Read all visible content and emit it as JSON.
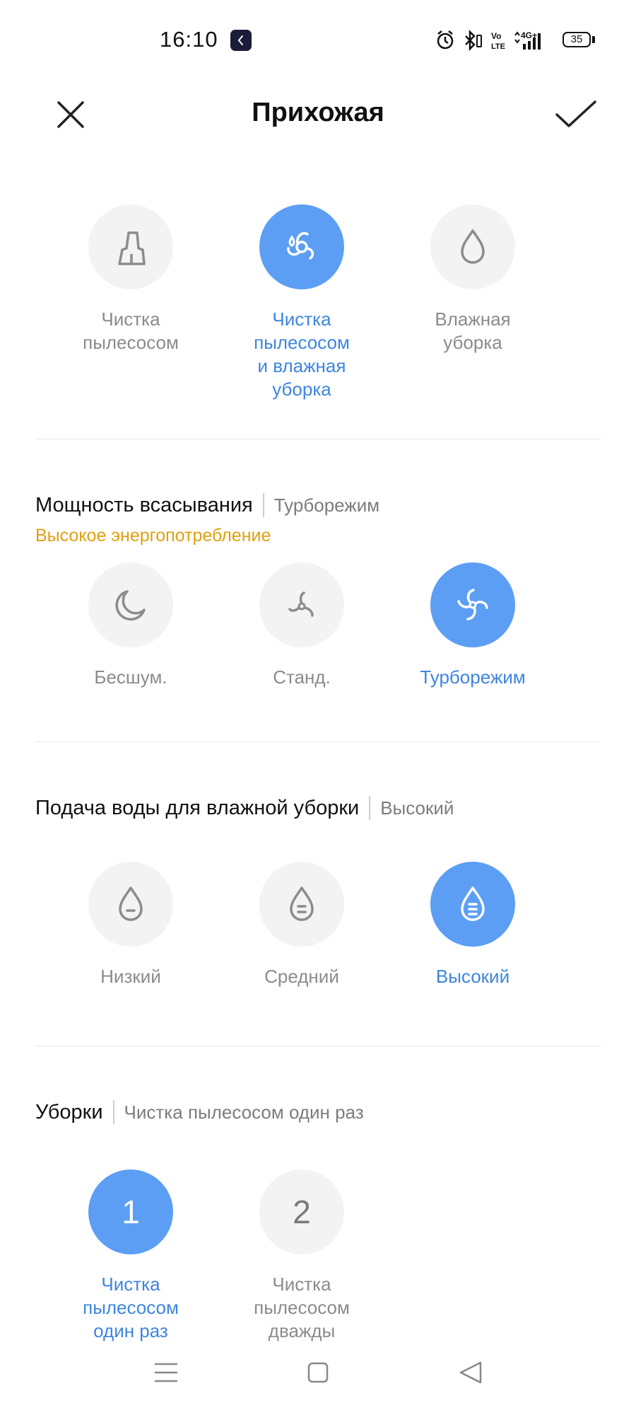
{
  "status_bar": {
    "time": "16:10",
    "battery": "35"
  },
  "header": {
    "title": "Прихожая"
  },
  "mode": {
    "options": [
      {
        "label_lines": [
          "Чистка",
          "пылесосом"
        ],
        "icon": "vacuum-icon",
        "selected": false
      },
      {
        "label_lines": [
          "Чистка",
          "пылесосом",
          "и влажная",
          "уборка"
        ],
        "icon": "vacuum-mop-icon",
        "selected": true
      },
      {
        "label_lines": [
          "Влажная",
          "уборка"
        ],
        "icon": "water-drop-icon",
        "selected": false
      }
    ]
  },
  "suction": {
    "title": "Мощность всасывания",
    "value": "Турборежим",
    "warning": "Высокое энергопотребление",
    "options": [
      {
        "label": "Бесшум.",
        "icon": "moon-icon",
        "selected": false
      },
      {
        "label": "Станд.",
        "icon": "fan-standard-icon",
        "selected": false
      },
      {
        "label": "Турборежим",
        "icon": "fan-turbo-icon",
        "selected": true
      }
    ]
  },
  "water": {
    "title": "Подача воды для влажной уборки",
    "value": "Высокий",
    "options": [
      {
        "label": "Низкий",
        "icon": "drop-low-icon",
        "selected": false
      },
      {
        "label": "Средний",
        "icon": "drop-medium-icon",
        "selected": false
      },
      {
        "label": "Высокий",
        "icon": "drop-high-icon",
        "selected": true
      }
    ]
  },
  "passes": {
    "title": "Уборки",
    "value": "Чистка пылесосом один раз",
    "options": [
      {
        "number": "1",
        "label_lines": [
          "Чистка",
          "пылесосом",
          "один раз"
        ],
        "selected": true
      },
      {
        "number": "2",
        "label_lines": [
          "Чистка",
          "пылесосом",
          "дважды"
        ],
        "selected": false
      }
    ]
  },
  "colors": {
    "accent": "#5c9ef4",
    "accent_text": "#3d85e0",
    "warning": "#e0a010",
    "inactive_circle": "#f3f3f3"
  }
}
